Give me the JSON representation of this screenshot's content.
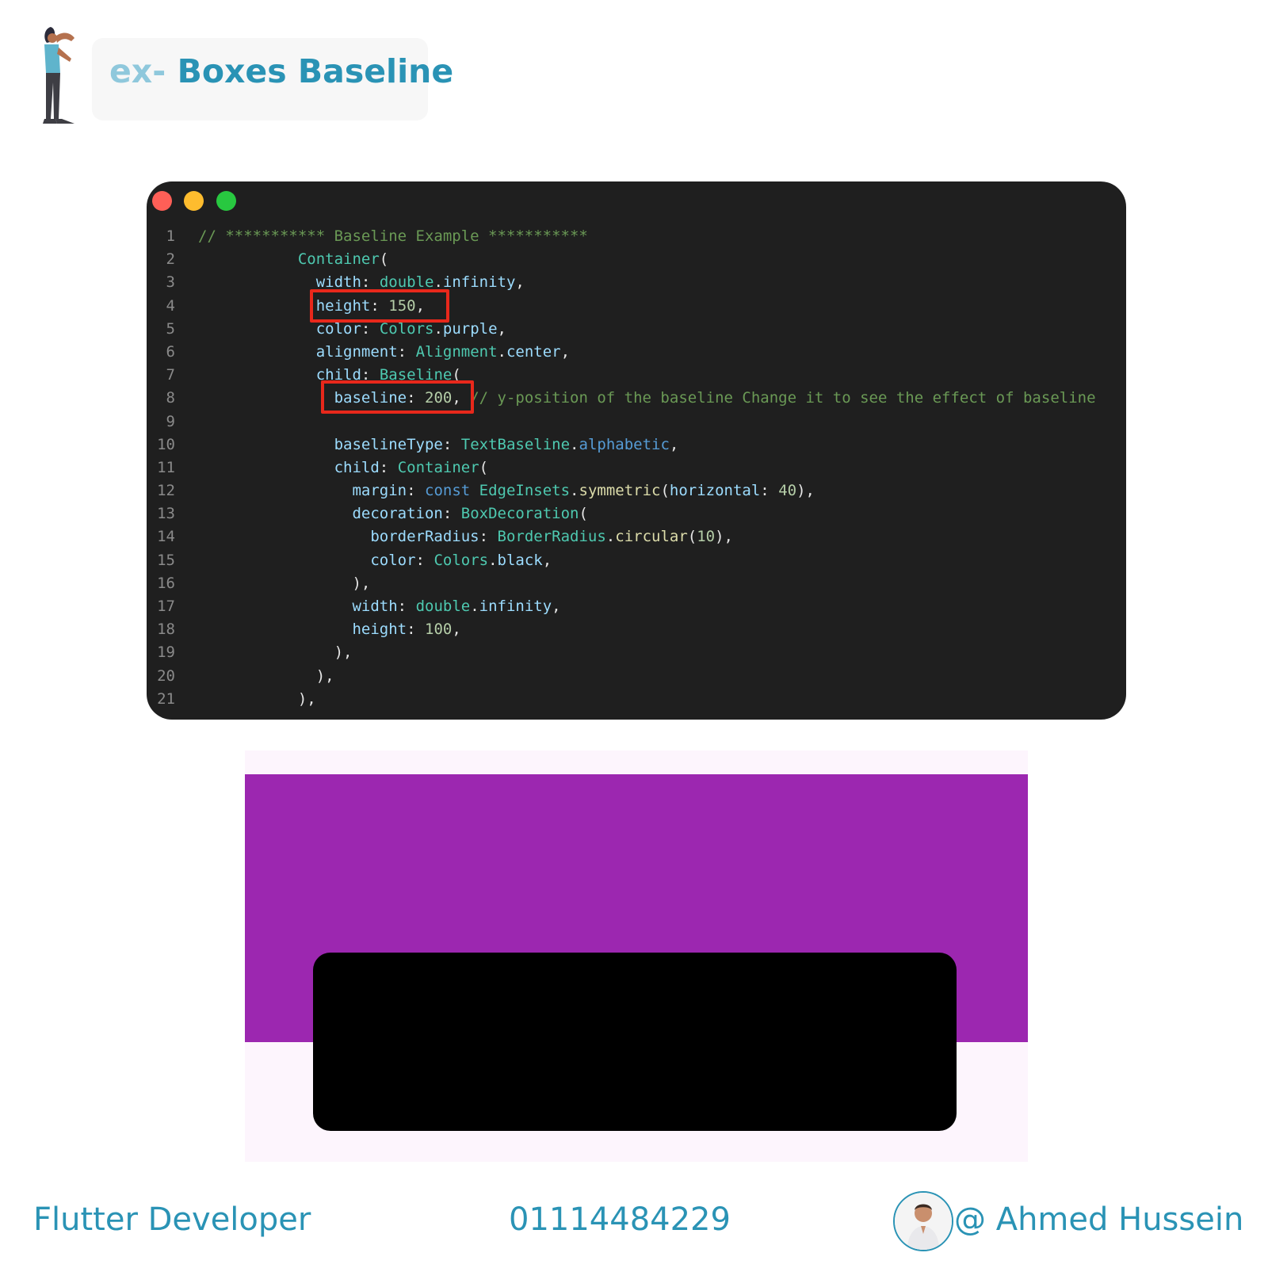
{
  "header": {
    "title_prefix": "ex-",
    "title_main": "Boxes Baseline"
  },
  "code_window": {
    "lines": [
      {
        "num": "1",
        "tokens": [
          {
            "t": "// *********** Baseline Example ***********",
            "c": "comment"
          }
        ]
      },
      {
        "num": "2",
        "tokens": [
          {
            "t": "           ",
            "c": "plain"
          },
          {
            "t": "Container",
            "c": "class"
          },
          {
            "t": "(",
            "c": "plain"
          }
        ]
      },
      {
        "num": "3",
        "tokens": [
          {
            "t": "             ",
            "c": "plain"
          },
          {
            "t": "width",
            "c": "prop"
          },
          {
            "t": ": ",
            "c": "plain"
          },
          {
            "t": "double",
            "c": "class"
          },
          {
            "t": ".",
            "c": "plain"
          },
          {
            "t": "infinity",
            "c": "prop"
          },
          {
            "t": ",",
            "c": "plain"
          }
        ]
      },
      {
        "num": "4",
        "tokens": [
          {
            "t": "             ",
            "c": "plain"
          },
          {
            "t": "height",
            "c": "prop"
          },
          {
            "t": ": ",
            "c": "plain"
          },
          {
            "t": "150",
            "c": "num"
          },
          {
            "t": ",",
            "c": "plain"
          }
        ]
      },
      {
        "num": "5",
        "tokens": [
          {
            "t": "             ",
            "c": "plain"
          },
          {
            "t": "color",
            "c": "prop"
          },
          {
            "t": ": ",
            "c": "plain"
          },
          {
            "t": "Colors",
            "c": "class"
          },
          {
            "t": ".",
            "c": "plain"
          },
          {
            "t": "purple",
            "c": "prop"
          },
          {
            "t": ",",
            "c": "plain"
          }
        ]
      },
      {
        "num": "6",
        "tokens": [
          {
            "t": "             ",
            "c": "plain"
          },
          {
            "t": "alignment",
            "c": "prop"
          },
          {
            "t": ": ",
            "c": "plain"
          },
          {
            "t": "Alignment",
            "c": "class"
          },
          {
            "t": ".",
            "c": "plain"
          },
          {
            "t": "center",
            "c": "prop"
          },
          {
            "t": ",",
            "c": "plain"
          }
        ]
      },
      {
        "num": "7",
        "tokens": [
          {
            "t": "             ",
            "c": "plain"
          },
          {
            "t": "child",
            "c": "prop"
          },
          {
            "t": ": ",
            "c": "plain"
          },
          {
            "t": "Baseline",
            "c": "class"
          },
          {
            "t": "(",
            "c": "plain"
          }
        ]
      },
      {
        "num": "8",
        "tokens": [
          {
            "t": "               ",
            "c": "plain"
          },
          {
            "t": "baseline",
            "c": "prop"
          },
          {
            "t": ": ",
            "c": "plain"
          },
          {
            "t": "200",
            "c": "num"
          },
          {
            "t": ", ",
            "c": "plain"
          },
          {
            "t": "// y-position of the baseline Change it to see the effect of baseline",
            "c": "comment"
          }
        ]
      },
      {
        "num": "9",
        "tokens": []
      },
      {
        "num": "10",
        "tokens": [
          {
            "t": "               ",
            "c": "plain"
          },
          {
            "t": "baselineType",
            "c": "prop"
          },
          {
            "t": ": ",
            "c": "plain"
          },
          {
            "t": "TextBaseline",
            "c": "class"
          },
          {
            "t": ".",
            "c": "plain"
          },
          {
            "t": "alphabetic",
            "c": "keyword"
          },
          {
            "t": ",",
            "c": "plain"
          }
        ]
      },
      {
        "num": "11",
        "tokens": [
          {
            "t": "               ",
            "c": "plain"
          },
          {
            "t": "child",
            "c": "prop"
          },
          {
            "t": ": ",
            "c": "plain"
          },
          {
            "t": "Container",
            "c": "class"
          },
          {
            "t": "(",
            "c": "plain"
          }
        ]
      },
      {
        "num": "12",
        "tokens": [
          {
            "t": "                 ",
            "c": "plain"
          },
          {
            "t": "margin",
            "c": "prop"
          },
          {
            "t": ": ",
            "c": "plain"
          },
          {
            "t": "const",
            "c": "keyword"
          },
          {
            "t": " ",
            "c": "plain"
          },
          {
            "t": "EdgeInsets",
            "c": "class"
          },
          {
            "t": ".",
            "c": "plain"
          },
          {
            "t": "symmetric",
            "c": "method"
          },
          {
            "t": "(",
            "c": "plain"
          },
          {
            "t": "horizontal",
            "c": "prop"
          },
          {
            "t": ": ",
            "c": "plain"
          },
          {
            "t": "40",
            "c": "num"
          },
          {
            "t": "),",
            "c": "plain"
          }
        ]
      },
      {
        "num": "13",
        "tokens": [
          {
            "t": "                 ",
            "c": "plain"
          },
          {
            "t": "decoration",
            "c": "prop"
          },
          {
            "t": ": ",
            "c": "plain"
          },
          {
            "t": "BoxDecoration",
            "c": "class"
          },
          {
            "t": "(",
            "c": "plain"
          }
        ]
      },
      {
        "num": "14",
        "tokens": [
          {
            "t": "                   ",
            "c": "plain"
          },
          {
            "t": "borderRadius",
            "c": "prop"
          },
          {
            "t": ": ",
            "c": "plain"
          },
          {
            "t": "BorderRadius",
            "c": "class"
          },
          {
            "t": ".",
            "c": "plain"
          },
          {
            "t": "circular",
            "c": "method"
          },
          {
            "t": "(",
            "c": "plain"
          },
          {
            "t": "10",
            "c": "num"
          },
          {
            "t": "),",
            "c": "plain"
          }
        ]
      },
      {
        "num": "15",
        "tokens": [
          {
            "t": "                   ",
            "c": "plain"
          },
          {
            "t": "color",
            "c": "prop"
          },
          {
            "t": ": ",
            "c": "plain"
          },
          {
            "t": "Colors",
            "c": "class"
          },
          {
            "t": ".",
            "c": "plain"
          },
          {
            "t": "black",
            "c": "prop"
          },
          {
            "t": ",",
            "c": "plain"
          }
        ]
      },
      {
        "num": "16",
        "tokens": [
          {
            "t": "                 ),",
            "c": "plain"
          }
        ]
      },
      {
        "num": "17",
        "tokens": [
          {
            "t": "                 ",
            "c": "plain"
          },
          {
            "t": "width",
            "c": "prop"
          },
          {
            "t": ": ",
            "c": "plain"
          },
          {
            "t": "double",
            "c": "class"
          },
          {
            "t": ".",
            "c": "plain"
          },
          {
            "t": "infinity",
            "c": "prop"
          },
          {
            "t": ",",
            "c": "plain"
          }
        ]
      },
      {
        "num": "18",
        "tokens": [
          {
            "t": "                 ",
            "c": "plain"
          },
          {
            "t": "height",
            "c": "prop"
          },
          {
            "t": ": ",
            "c": "plain"
          },
          {
            "t": "100",
            "c": "num"
          },
          {
            "t": ",",
            "c": "plain"
          }
        ]
      },
      {
        "num": "19",
        "tokens": [
          {
            "t": "               ),",
            "c": "plain"
          }
        ]
      },
      {
        "num": "20",
        "tokens": [
          {
            "t": "             ),",
            "c": "plain"
          }
        ]
      },
      {
        "num": "21",
        "tokens": [
          {
            "t": "           ),",
            "c": "plain"
          }
        ]
      }
    ]
  },
  "preview": {
    "background_color": "#fdf5fd",
    "purple_color": "#9c27b0",
    "black_color": "#000000"
  },
  "footer": {
    "role": "Flutter Developer",
    "phone": "01114484229",
    "handle": "@ Ahmed Hussein"
  },
  "colors": {
    "accent": "#2a93b5",
    "highlight_border": "#e8281b"
  }
}
